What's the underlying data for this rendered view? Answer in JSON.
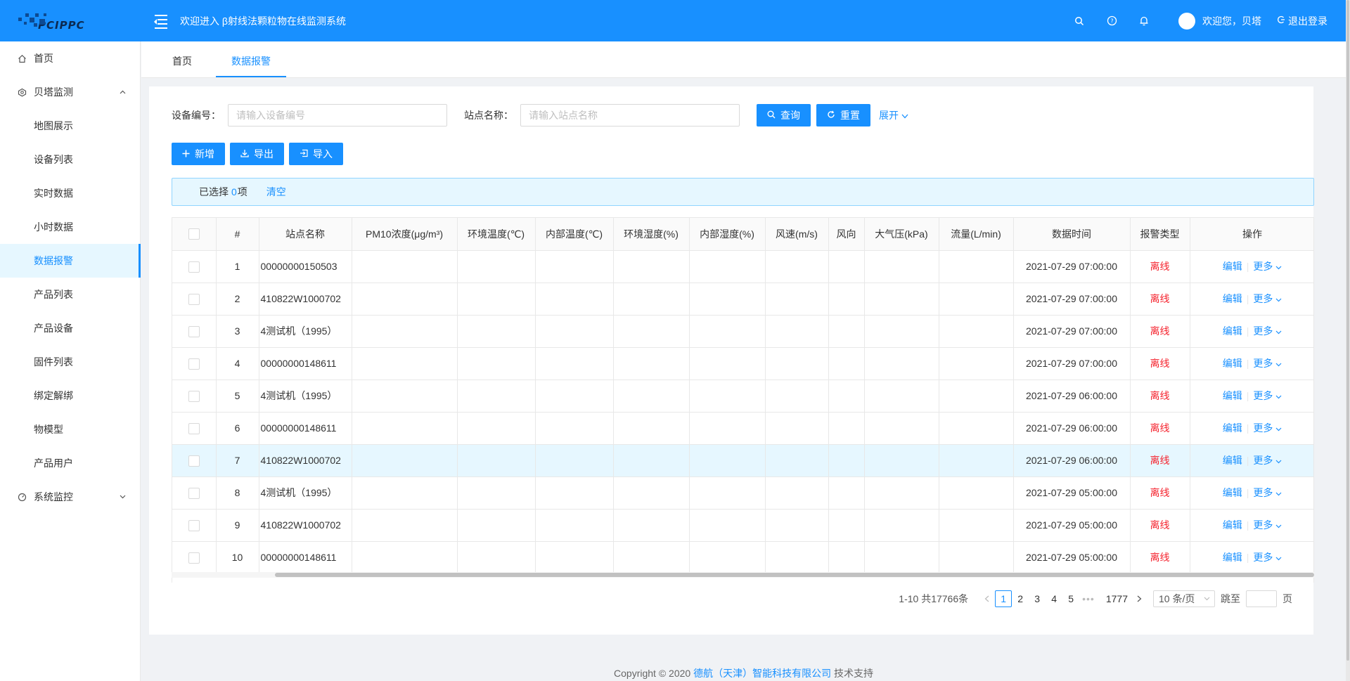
{
  "header": {
    "logo_text": "PCIPPC",
    "title": "欢迎进入 β射线法颗粒物在线监测系统",
    "welcome": "欢迎您，贝塔",
    "logout": "退出登录",
    "bg_color": "#1890ff"
  },
  "sidebar": {
    "items": [
      {
        "label": "首页",
        "icon": "home-icon"
      },
      {
        "label": "贝塔监测",
        "icon": "monitor-icon",
        "arrow": "⌃"
      },
      {
        "label": "地图展示"
      },
      {
        "label": "设备列表"
      },
      {
        "label": "实时数据"
      },
      {
        "label": "小时数据"
      },
      {
        "label": "数据报警",
        "active": true
      },
      {
        "label": "产品列表"
      },
      {
        "label": "产品设备"
      },
      {
        "label": "固件列表"
      },
      {
        "label": "绑定解绑"
      },
      {
        "label": "物模型"
      },
      {
        "label": "产品用户"
      },
      {
        "label": "系统监控",
        "icon": "dashboard-icon",
        "arrow": "⌄"
      }
    ]
  },
  "tabs": [
    {
      "label": "首页"
    },
    {
      "label": "数据报警",
      "active": true
    }
  ],
  "filters": {
    "device_label": "设备编号：",
    "device_placeholder": "请输入设备编号",
    "station_label": "站点名称：",
    "station_placeholder": "请输入站点名称",
    "search_label": "查询",
    "reset_label": "重置",
    "expand_label": "展开"
  },
  "actions": {
    "add_label": "新增",
    "export_label": "导出",
    "import_label": "导入"
  },
  "selection": {
    "prefix": "已选择",
    "count": "0",
    "suffix": "项",
    "clear": "清空"
  },
  "table": {
    "columns": [
      "#",
      "站点名称",
      "PM10浓度(μg/m³)",
      "环境温度(℃)",
      "内部温度(℃)",
      "环境湿度(%)",
      "内部湿度(%)",
      "风速(m/s)",
      "风向",
      "大气压(kPa)",
      "流量(L/min)",
      "数据时间",
      "报警类型",
      "操作"
    ],
    "edit_label": "编辑",
    "more_label": "更多",
    "rows": [
      {
        "no": "1",
        "station": "00000000150503",
        "time": "2021-07-29 07:00:00",
        "alarm": "离线"
      },
      {
        "no": "2",
        "station": "410822W1000702",
        "time": "2021-07-29 07:00:00",
        "alarm": "离线"
      },
      {
        "no": "3",
        "station": "4测试机（1995）",
        "time": "2021-07-29 07:00:00",
        "alarm": "离线"
      },
      {
        "no": "4",
        "station": "00000000148611",
        "time": "2021-07-29 07:00:00",
        "alarm": "离线"
      },
      {
        "no": "5",
        "station": "4测试机（1995）",
        "time": "2021-07-29 06:00:00",
        "alarm": "离线"
      },
      {
        "no": "6",
        "station": "00000000148611",
        "time": "2021-07-29 06:00:00",
        "alarm": "离线"
      },
      {
        "no": "7",
        "station": "410822W1000702",
        "time": "2021-07-29 06:00:00",
        "alarm": "离线",
        "highlight": true
      },
      {
        "no": "8",
        "station": "4测试机（1995）",
        "time": "2021-07-29 05:00:00",
        "alarm": "离线"
      },
      {
        "no": "9",
        "station": "410822W1000702",
        "time": "2021-07-29 05:00:00",
        "alarm": "离线"
      },
      {
        "no": "10",
        "station": "00000000148611",
        "time": "2021-07-29 05:00:00",
        "alarm": "离线"
      }
    ]
  },
  "pagination": {
    "total": "1-10 共17766条",
    "pages": [
      "1",
      "2",
      "3",
      "4",
      "5"
    ],
    "current": "1",
    "last": "1777",
    "dots": "•••",
    "page_size": "10 条/页",
    "jump_label": "跳至",
    "page_suffix": "页"
  },
  "footer": {
    "prefix": "Copyright © 2020",
    "company": "德航（天津）智能科技有限公司",
    "suffix": "技术支持"
  }
}
